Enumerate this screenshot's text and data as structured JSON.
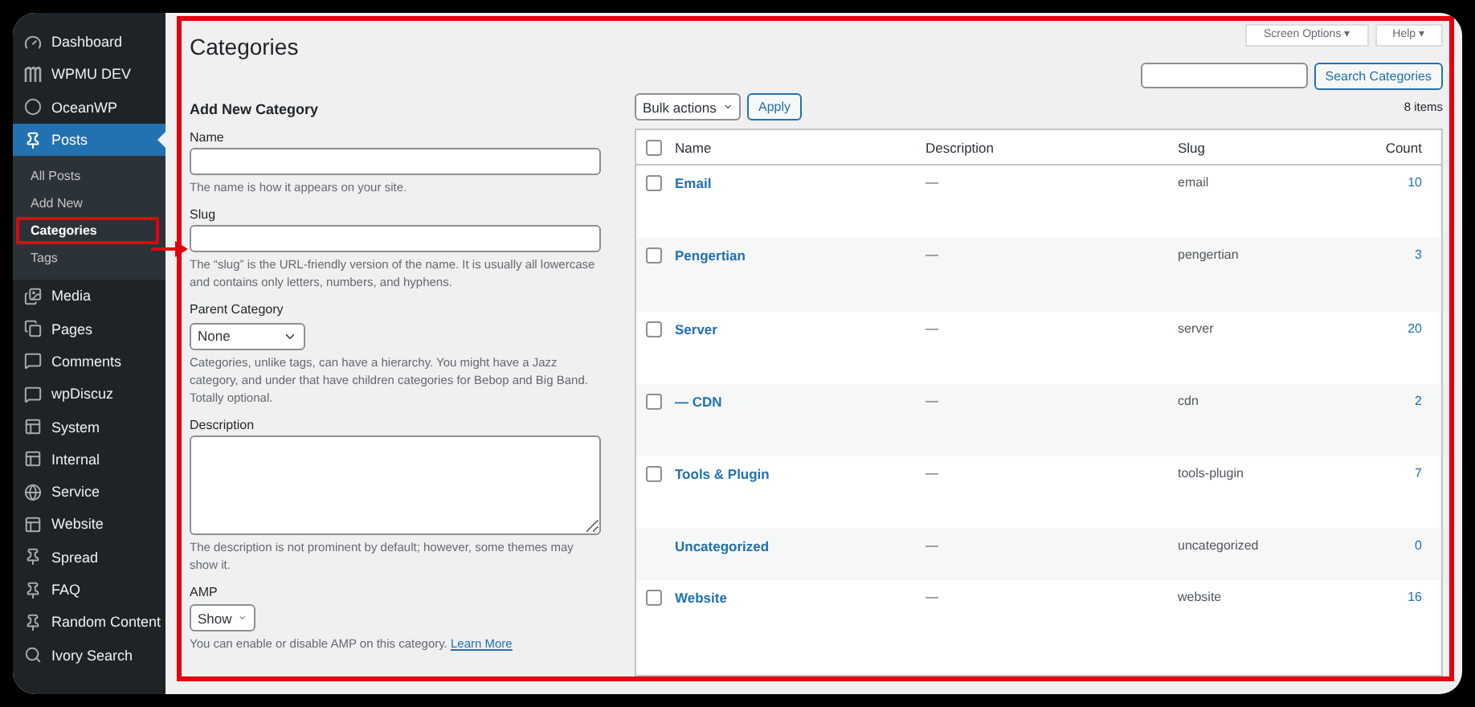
{
  "sidebar": {
    "items": [
      {
        "label": "Dashboard",
        "selected": false
      },
      {
        "label": "WPMU DEV",
        "selected": false
      },
      {
        "label": "OceanWP",
        "selected": false
      },
      {
        "label": "Posts",
        "selected": true,
        "children": [
          {
            "label": "All Posts",
            "selected": false,
            "highlighted": false
          },
          {
            "label": "Add New",
            "selected": false,
            "highlighted": false
          },
          {
            "label": "Categories",
            "selected": true,
            "highlighted": true
          },
          {
            "label": "Tags",
            "selected": false,
            "highlighted": false
          }
        ]
      },
      {
        "label": "Media",
        "selected": false
      },
      {
        "label": "Pages",
        "selected": false
      },
      {
        "label": "Comments",
        "selected": false
      },
      {
        "label": "wpDiscuz",
        "selected": false
      },
      {
        "label": "System",
        "selected": false
      },
      {
        "label": "Internal",
        "selected": false
      },
      {
        "label": "Service",
        "selected": false
      },
      {
        "label": "Website",
        "selected": false
      },
      {
        "label": "Spread",
        "selected": false
      },
      {
        "label": "FAQ",
        "selected": false
      },
      {
        "label": "Random Content",
        "selected": false
      },
      {
        "label": "Ivory Search",
        "selected": false
      }
    ]
  },
  "screen_meta": [
    "Screen Options ▾",
    "Help ▾"
  ],
  "page_title": "Categories",
  "search": {
    "button": "Search Categories"
  },
  "form": {
    "title": "Add New Category",
    "name": {
      "label": "Name",
      "help": "The name is how it appears on your site."
    },
    "slug": {
      "label": "Slug",
      "help": "The “slug” is the URL-friendly version of the name. It is usually all lowercase and contains only letters, numbers, and hyphens."
    },
    "parent": {
      "label": "Parent Category",
      "value": "None",
      "help": "Categories, unlike tags, can have a hierarchy. You might have a Jazz category, and under that have children categories for Bebop and Big Band. Totally optional."
    },
    "description": {
      "label": "Description",
      "help": "The description is not prominent by default; however, some themes may show it."
    },
    "amp": {
      "label": "AMP",
      "value": "Show",
      "help": "You can enable or disable AMP on this category.",
      "link": "Learn More"
    }
  },
  "table": {
    "bulk_actions": "Bulk actions",
    "apply": "Apply",
    "count_text": "8 items",
    "select_all_checked": false,
    "columns": [
      "Name",
      "Description",
      "Slug",
      "Count"
    ],
    "rows": [
      {
        "kind": "checkable",
        "checked": false,
        "name": "Email",
        "description": "—",
        "slug": "email",
        "count": "10"
      },
      {
        "kind": "checkable",
        "checked": false,
        "name": "Pengertian",
        "description": "—",
        "slug": "pengertian",
        "count": "3"
      },
      {
        "kind": "checkable",
        "checked": false,
        "name": "Server",
        "description": "—",
        "slug": "server",
        "count": "20"
      },
      {
        "kind": "checkable",
        "checked": false,
        "name": "— CDN",
        "description": "—",
        "slug": "cdn",
        "count": "2"
      },
      {
        "kind": "checkable",
        "checked": false,
        "name": "Tools & Plugin",
        "description": "—",
        "slug": "tools-plugin",
        "count": "7"
      },
      {
        "kind": "fixed",
        "name": "Uncategorized",
        "description": "—",
        "slug": "uncategorized",
        "count": "0"
      },
      {
        "kind": "checkable",
        "checked": false,
        "name": "Website",
        "description": "—",
        "slug": "website",
        "count": "16"
      }
    ]
  }
}
